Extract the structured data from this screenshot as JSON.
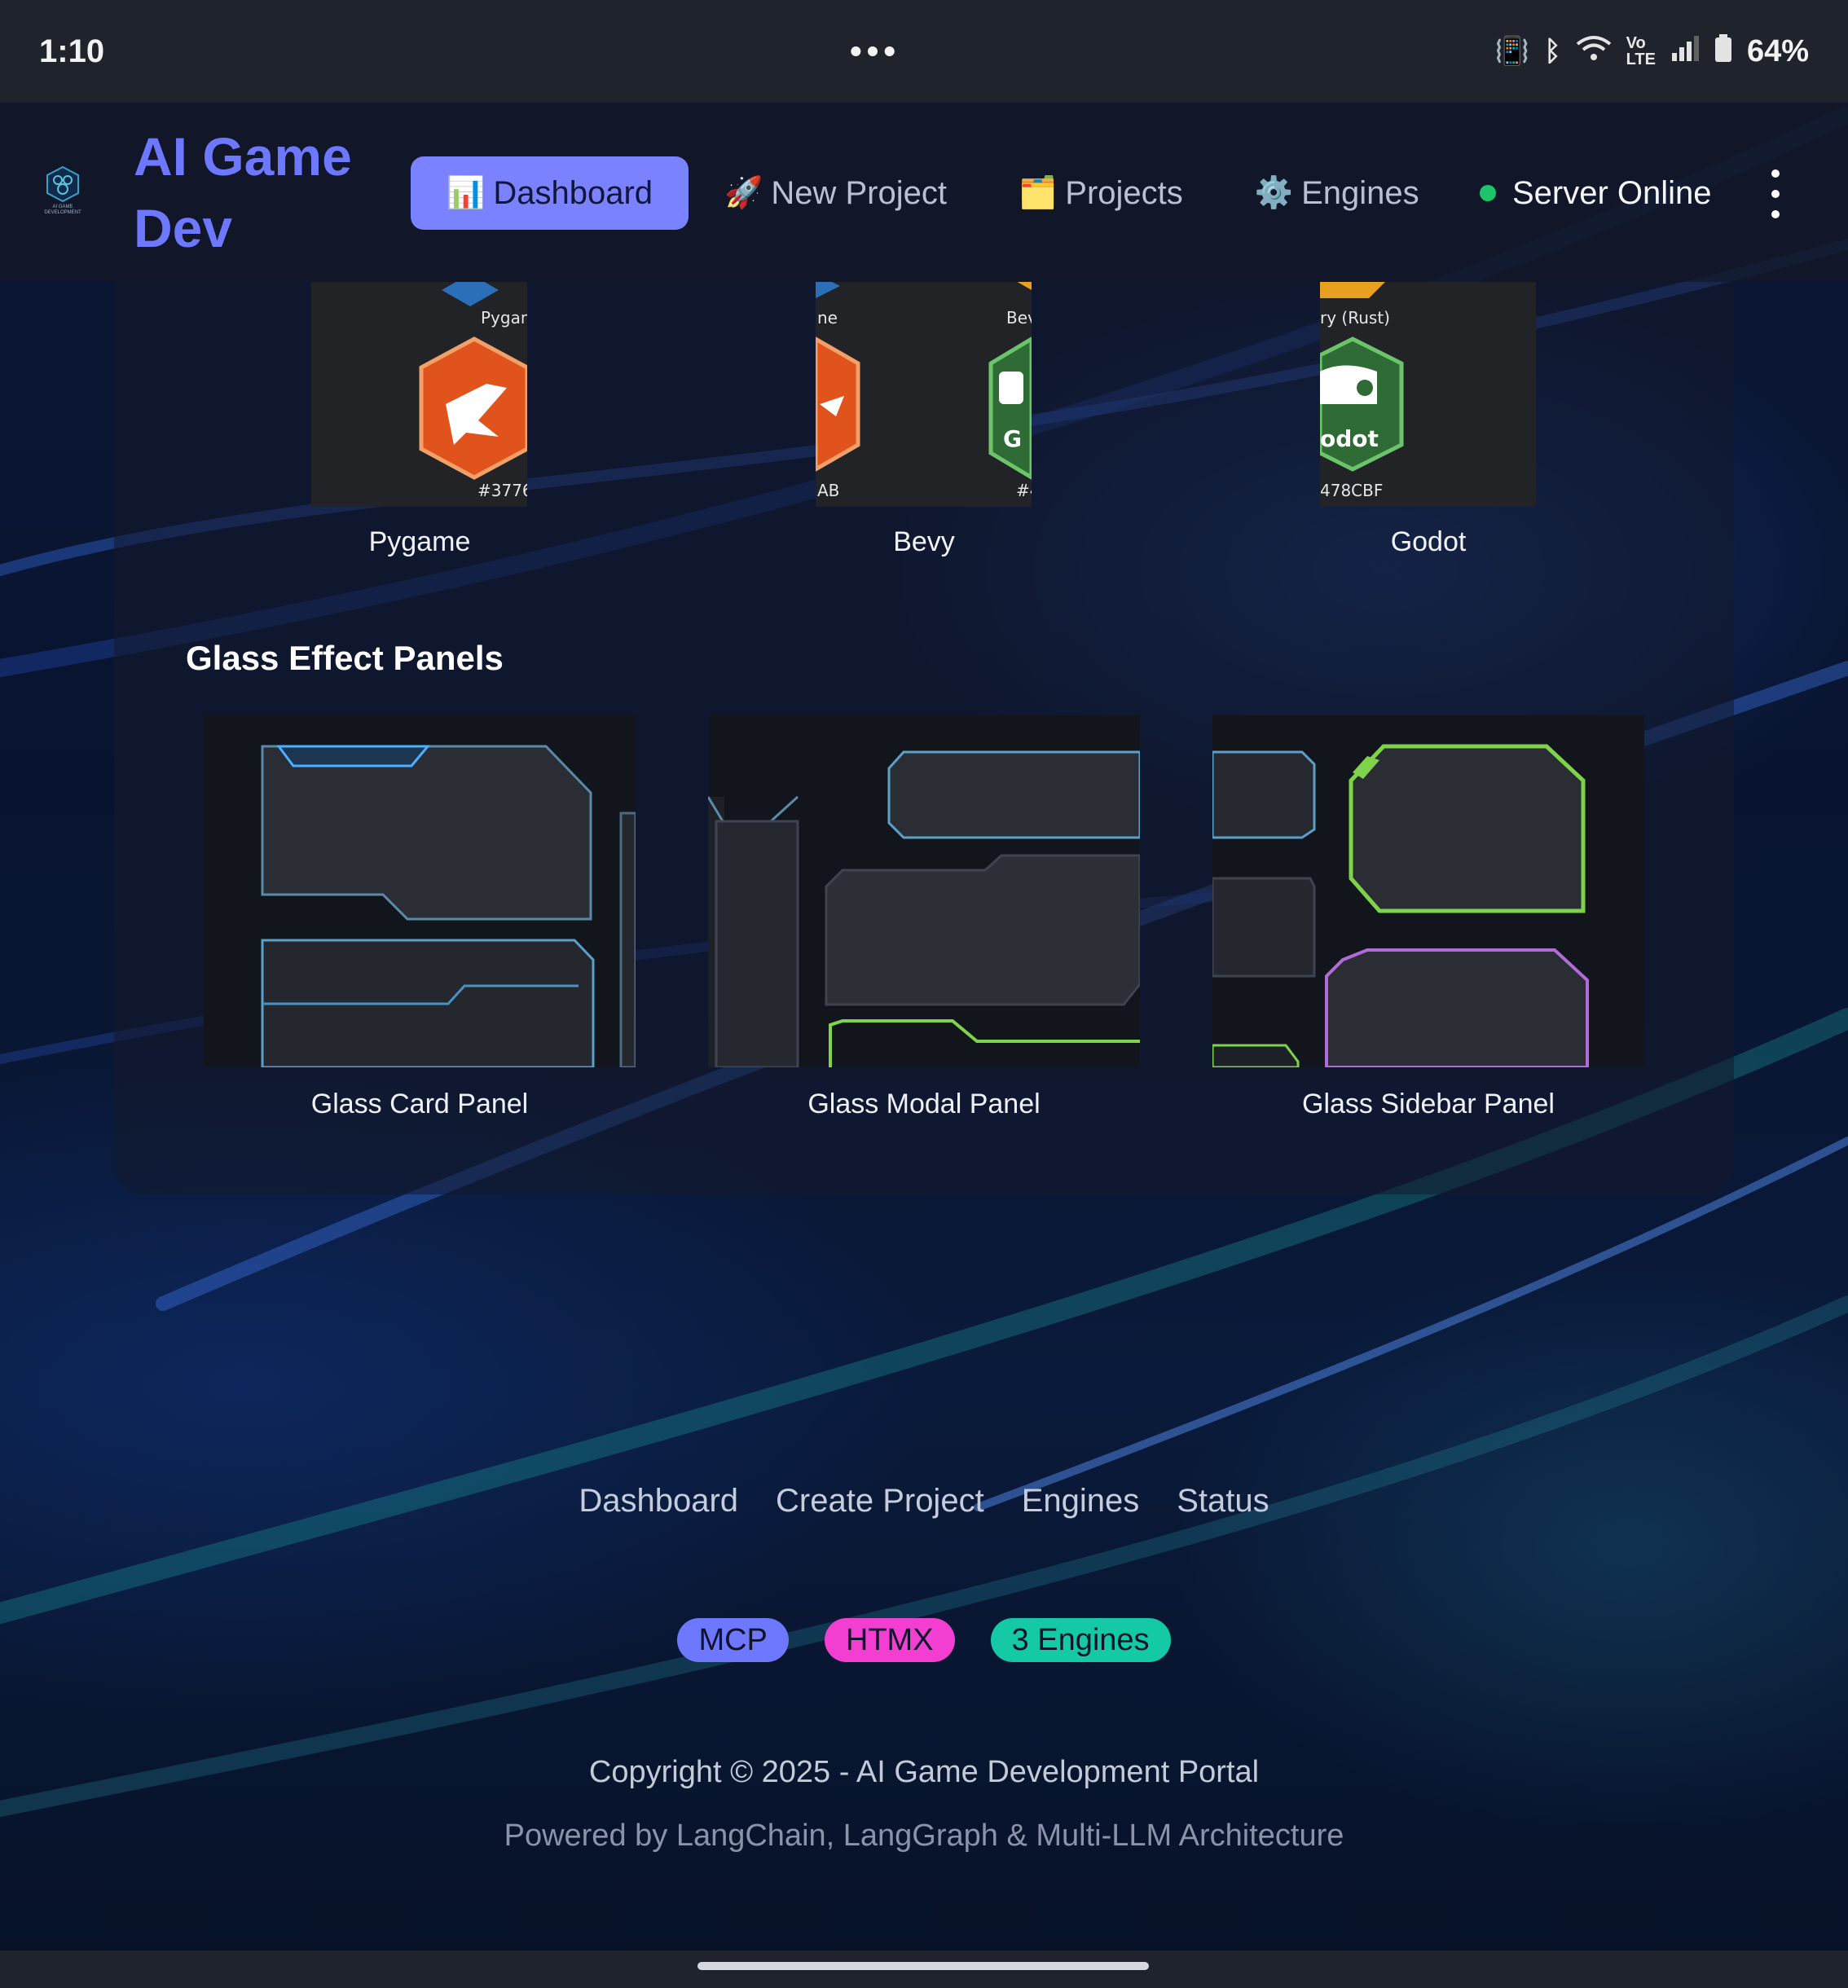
{
  "status_bar": {
    "time": "1:10",
    "center": "•••",
    "battery": "64%",
    "icons": [
      "vibrate-icon",
      "bluetooth-icon",
      "wifi-icon",
      "volte-icon",
      "signal-icon",
      "battery-icon"
    ]
  },
  "header": {
    "brand": "AI Game Dev",
    "logo_caption": "AI GAME DEVELOPMENT",
    "nav": [
      {
        "emoji": "📊",
        "label": "Dashboard",
        "active": true
      },
      {
        "emoji": "🚀",
        "label": "New Project",
        "active": false
      },
      {
        "emoji": "🗂️",
        "label": "Projects",
        "active": false
      },
      {
        "emoji": "⚙️",
        "label": "Engines",
        "active": false
      }
    ],
    "server_status": "Server Online",
    "server_color": "#1cc46a"
  },
  "engines": {
    "items": [
      {
        "label": "Pygame",
        "top_text": "Pygan",
        "bottom_text": "#3776/"
      },
      {
        "label": "Bevy",
        "top_left": "ne",
        "top_right": "Bev",
        "bottom_left": "AB",
        "bottom_right": "#4",
        "badge_text": "G"
      },
      {
        "label": "Godot",
        "top_text": "ry (Rust)",
        "badge_text": "odot",
        "bottom_text": "478CBF"
      }
    ]
  },
  "glass_section": {
    "title": "Glass Effect Panels",
    "panels": [
      {
        "label": "Glass Card Panel"
      },
      {
        "label": "Glass Modal Panel"
      },
      {
        "label": "Glass Sidebar Panel"
      }
    ]
  },
  "footer": {
    "links": [
      "Dashboard",
      "Create Project",
      "Engines",
      "Status"
    ],
    "badges": [
      {
        "label": "MCP",
        "color": "#6e78ff"
      },
      {
        "label": "HTMX",
        "color": "#f23fd2"
      },
      {
        "label": "3 Engines",
        "color": "#14c9a6"
      }
    ],
    "copyright": "Copyright © 2025 - AI Game Development Portal",
    "powered": "Powered by LangChain, LangGraph & Multi-LLM Architecture"
  },
  "colors": {
    "accent": "#7b82ff",
    "brand": "#6e78ff",
    "background": "#0a1430"
  }
}
